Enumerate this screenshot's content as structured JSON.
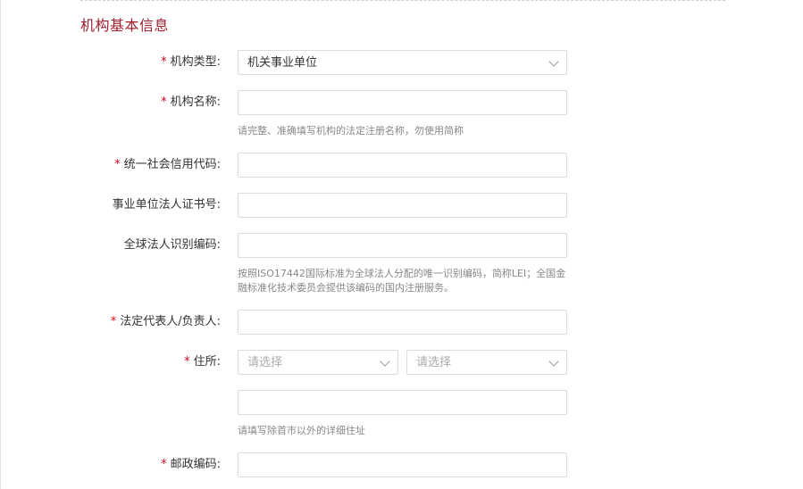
{
  "section": {
    "title": "机构基本信息"
  },
  "fields": {
    "org_type": {
      "label": "机构类型:",
      "required": true,
      "value": "机关事业单位"
    },
    "org_name": {
      "label": "机构名称:",
      "required": true,
      "value": "",
      "hint": "请完整、准确填写机构的法定注册名称，勿使用简称"
    },
    "credit_code": {
      "label": "统一社会信用代码:",
      "required": true,
      "value": ""
    },
    "public_cert": {
      "label": "事业单位法人证书号:",
      "required": false,
      "value": ""
    },
    "lei": {
      "label": "全球法人识别编码:",
      "required": false,
      "value": "",
      "hint_line1": "按照ISO17442国际标准为全球法人分配的唯一识别编码，简称LEI；全国金",
      "hint_line2": "融标准化技术委员会提供该编码的国内注册服务。"
    },
    "legal_rep": {
      "label": "法定代表人/负责人:",
      "required": true,
      "value": ""
    },
    "address": {
      "label": "住所:",
      "required": true,
      "select1_placeholder": "请选择",
      "select2_placeholder": "请选择",
      "detail_value": "",
      "hint": "请填写除首市以外的详细住址"
    },
    "postal_code": {
      "label": "邮政编码:",
      "required": true,
      "value": ""
    }
  },
  "required_mark": "*"
}
